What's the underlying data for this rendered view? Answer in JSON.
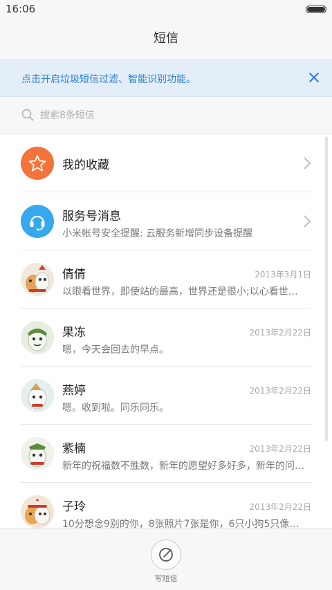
{
  "status_bar": {
    "time": "16:06"
  },
  "header": {
    "title": "短信"
  },
  "banner": {
    "text": "点击开启垃圾短信过滤、智能识别功能。"
  },
  "search": {
    "placeholder": "搜索8条短信"
  },
  "conversations": [
    {
      "name": "我的收藏",
      "preview": "",
      "date": "",
      "avatar": "star-icon"
    },
    {
      "name": "服务号消息",
      "preview": "小米帐号安全提醒: 云服务新增同步设备提醒",
      "date": "",
      "avatar": "headset-icon"
    },
    {
      "name": "倩倩",
      "preview": "以眼看世界，即使站的最高，世界还是很小;以心看世界，...",
      "date": "2013年3月1日",
      "avatar": "mascot-avatar"
    },
    {
      "name": "果冻",
      "preview": "嗯，今天会回去的早点。",
      "date": "2013年2月22日",
      "avatar": "mascot-avatar"
    },
    {
      "name": "燕婷",
      "preview": "嗯。收到啦。同乐同乐。",
      "date": "2013年2月22日",
      "avatar": "mascot-avatar"
    },
    {
      "name": "紫楠",
      "preview": "新年的祝福数不胜数，新年的愿望好多好多，新年的问候...",
      "date": "2013年2月22日",
      "avatar": "mascot-avatar"
    },
    {
      "name": "子玲",
      "preview": "10分想念9别的你，8张照片7张是你，6只小狗5只像你，4...",
      "date": "2013年2月22日",
      "avatar": "mascot-avatar"
    }
  ],
  "bottom_bar": {
    "compose_label": "写短信"
  },
  "colors": {
    "accent": "#2b7fd4",
    "favorites": "#f2743a",
    "service": "#36a9ee"
  }
}
